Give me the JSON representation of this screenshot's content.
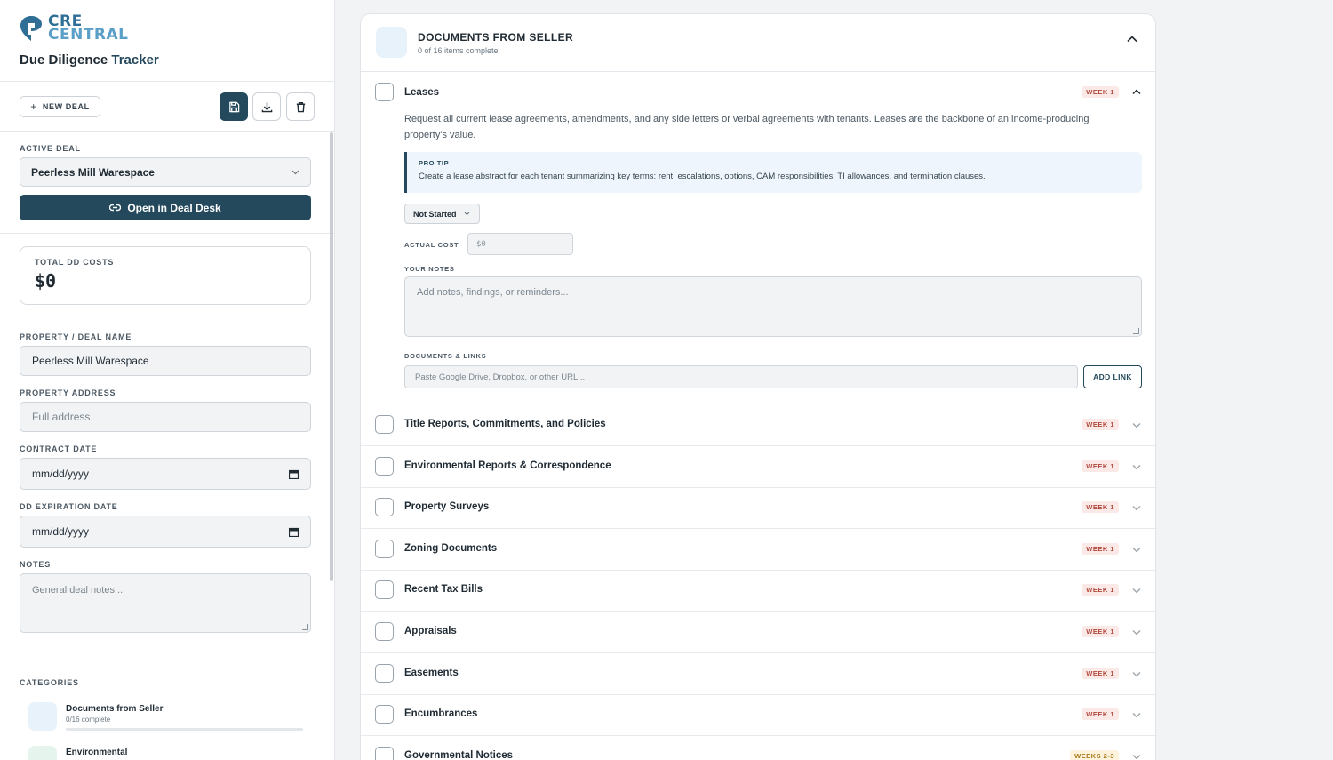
{
  "brand": {
    "line1": "CRE",
    "line2": "CENTRAL",
    "title_main": "Due Diligence",
    "title_accent": "Tracker"
  },
  "toolbar": {
    "new_deal": "NEW DEAL"
  },
  "active_deal": {
    "label": "ACTIVE DEAL",
    "value": "Peerless Mill Warespace",
    "open_button": "Open in Deal Desk"
  },
  "costs": {
    "label": "TOTAL DD COSTS",
    "value": "$0"
  },
  "form": {
    "name_label": "PROPERTY / DEAL NAME",
    "name_value": "Peerless Mill Warespace",
    "address_label": "PROPERTY ADDRESS",
    "address_placeholder": "Full address",
    "contract_label": "CONTRACT DATE",
    "contract_value": "mm/dd/yyyy",
    "dd_label": "DD EXPIRATION DATE",
    "dd_value": "mm/dd/yyyy",
    "notes_label": "NOTES",
    "notes_placeholder": "General deal notes..."
  },
  "categories": {
    "label": "CATEGORIES",
    "items": [
      {
        "name": "Documents from Seller",
        "sub": "0/16 complete",
        "progress": 0
      },
      {
        "name": "Environmental",
        "sub": "",
        "progress": 0
      }
    ]
  },
  "panel": {
    "title": "DOCUMENTS FROM SELLER",
    "subtitle": "0 of 16 items complete",
    "expanded": {
      "name": "Leases",
      "badge": "WEEK 1",
      "description": "Request all current lease agreements, amendments, and any side letters or verbal agreements with tenants. Leases are the backbone of an income-producing property's value.",
      "tip_label": "PRO TIP",
      "tip_text": "Create a lease abstract for each tenant summarizing key terms: rent, escalations, options, CAM responsibilities, TI allowances, and termination clauses.",
      "status": "Not Started",
      "cost_label": "ACTUAL COST",
      "cost_placeholder": "$0",
      "notes_label": "YOUR NOTES",
      "notes_placeholder": "Add notes, findings, or reminders...",
      "links_label": "DOCUMENTS & LINKS",
      "links_placeholder": "Paste Google Drive, Dropbox, or other URL...",
      "add_link": "ADD LINK"
    },
    "items": [
      {
        "name": "Title Reports, Commitments, and Policies",
        "badge": "WEEK 1"
      },
      {
        "name": "Environmental Reports & Correspondence",
        "badge": "WEEK 1"
      },
      {
        "name": "Property Surveys",
        "badge": "WEEK 1"
      },
      {
        "name": "Zoning Documents",
        "badge": "WEEK 1"
      },
      {
        "name": "Recent Tax Bills",
        "badge": "WEEK 1"
      },
      {
        "name": "Appraisals",
        "badge": "WEEK 1"
      },
      {
        "name": "Easements",
        "badge": "WEEK 1"
      },
      {
        "name": "Encumbrances",
        "badge": "WEEK 1"
      },
      {
        "name": "Governmental Notices",
        "badge": "WEEKS 2-3"
      }
    ]
  },
  "colors": {
    "primary": "#24485c",
    "badge_red": "#b0473a",
    "badge_amber": "#a9781a"
  }
}
